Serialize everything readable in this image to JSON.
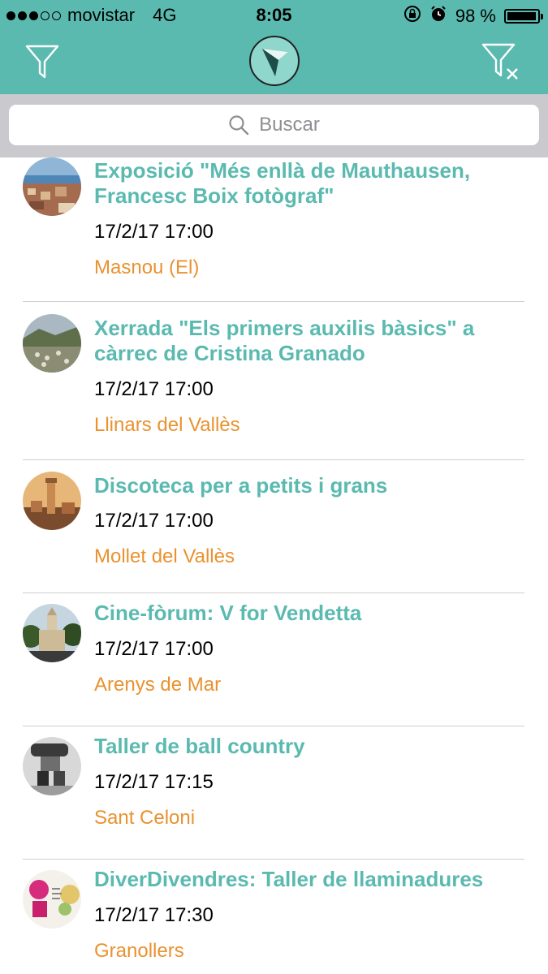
{
  "status_bar": {
    "signal_bars_filled": 3,
    "signal_bars_total": 5,
    "carrier": "movistar",
    "network": "4G",
    "time": "8:05",
    "battery_percent": "98 %",
    "battery_level": 0.98
  },
  "nav": {
    "filter_icon": "filter-icon",
    "clear_filter_icon": "clear-filter-icon",
    "logo_icon": "app-logo"
  },
  "search": {
    "placeholder": "Buscar"
  },
  "colors": {
    "accent": "#5bbab0",
    "place": "#e9922f",
    "search_bg": "#c9c9ce"
  },
  "events": [
    {
      "title": "Exposició \"Més enllà de Mauthausen, Francesc Boix fotògraf\"",
      "datetime": "17/2/17 17:00",
      "place": "Masnou (El)"
    },
    {
      "title": "Xerrada \"Els primers auxilis bàsics\" a càrrec de Cristina Granado",
      "datetime": "17/2/17 17:00",
      "place": "Llinars del Vallès"
    },
    {
      "title": "Discoteca per a petits i grans",
      "datetime": "17/2/17 17:00",
      "place": "Mollet del Vallès"
    },
    {
      "title": "Cine-fòrum: V for Vendetta",
      "datetime": "17/2/17 17:00",
      "place": "Arenys de Mar"
    },
    {
      "title": "Taller de ball country",
      "datetime": "17/2/17 17:15",
      "place": "Sant Celoni"
    },
    {
      "title": "DiverDivendres: Taller de llaminadures",
      "datetime": "17/2/17 17:30",
      "place": "Granollers"
    }
  ]
}
